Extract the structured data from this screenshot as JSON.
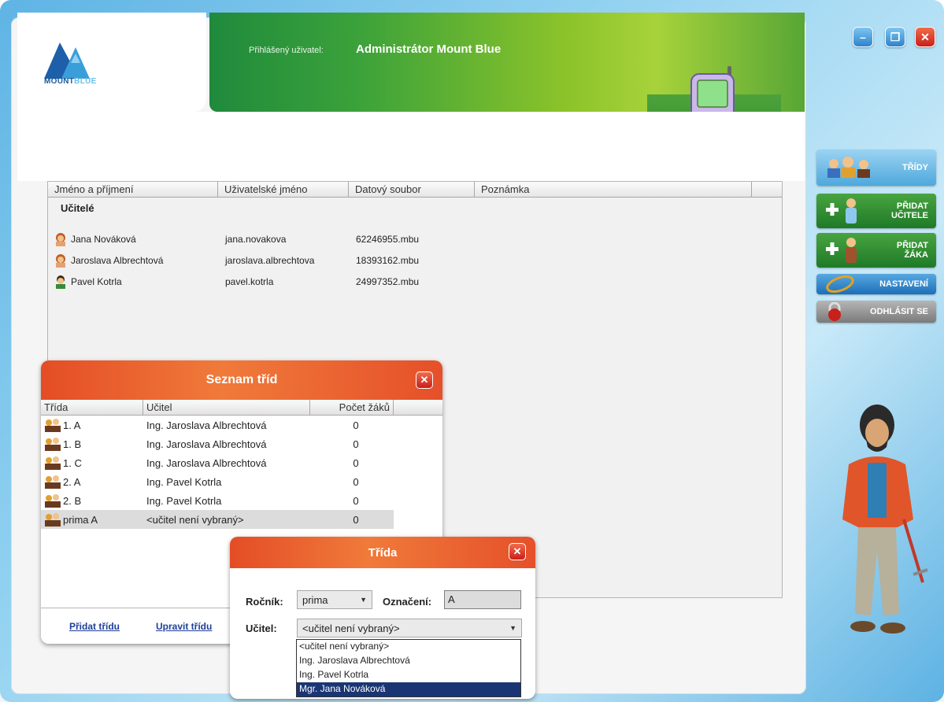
{
  "header": {
    "logo_text_1": "MOUNT",
    "logo_text_2": "BLUE",
    "logged_label": "Přihlášený uživatel:",
    "logged_user": "Administrátor Mount Blue"
  },
  "window_controls": {
    "minimize": "–",
    "maximize": "❐",
    "close": "✕"
  },
  "sidebar": {
    "trida": "TŘÍDY",
    "add_teacher_1": "PŘIDAT",
    "add_teacher_2": "UČITELE",
    "add_student_1": "PŘIDAT",
    "add_student_2": "ŽÁKA",
    "settings": "NASTAVENÍ",
    "logout": "ODHLÁSIT SE"
  },
  "main_table": {
    "columns": [
      "Jméno a příjmení",
      "Uživatelské jméno",
      "Datový soubor",
      "Poznámka"
    ],
    "section": "Učitelé",
    "rows": [
      {
        "name": "Jana Nováková",
        "user": "jana.novakova",
        "file": "62246955.mbu",
        "gender": "female"
      },
      {
        "name": "Jaroslava Albrechtová",
        "user": "jaroslava.albrechtova",
        "file": "18393162.mbu",
        "gender": "female"
      },
      {
        "name": "Pavel Kotrla",
        "user": "pavel.kotrla",
        "file": "24997352.mbu",
        "gender": "male"
      }
    ]
  },
  "classes_dialog": {
    "title": "Seznam tříd",
    "columns": [
      "Třída",
      "Učitel",
      "Počet žáků"
    ],
    "rows": [
      {
        "trida": "1. A",
        "ucitel": "Ing. Jaroslava Albrechtová",
        "pocet": "0"
      },
      {
        "trida": "1. B",
        "ucitel": "Ing. Jaroslava Albrechtová",
        "pocet": "0"
      },
      {
        "trida": "1. C",
        "ucitel": "Ing. Jaroslava Albrechtová",
        "pocet": "0"
      },
      {
        "trida": "2. A",
        "ucitel": "Ing. Pavel Kotrla",
        "pocet": "0"
      },
      {
        "trida": "2. B",
        "ucitel": "Ing. Pavel Kotrla",
        "pocet": "0"
      },
      {
        "trida": "prima A",
        "ucitel": "<učitel není vybraný>",
        "pocet": "0"
      }
    ],
    "add_link": "Přidat třídu",
    "edit_link": "Upravit třídu",
    "close": "✕"
  },
  "class_form": {
    "title": "Třída",
    "rocnik_label": "Ročník:",
    "rocnik_value": "prima",
    "oznaceni_label": "Označení:",
    "oznaceni_value": "A",
    "ucitel_label": "Učitel:",
    "ucitel_value": "<učitel není vybraný>",
    "close": "✕",
    "ucitel_options": [
      "<učitel není vybraný>",
      "Ing. Jaroslava Albrechtová",
      "Ing. Pavel Kotrla",
      "Mgr. Jana Nováková"
    ],
    "highlighted_option": "Mgr. Jana Nováková"
  }
}
